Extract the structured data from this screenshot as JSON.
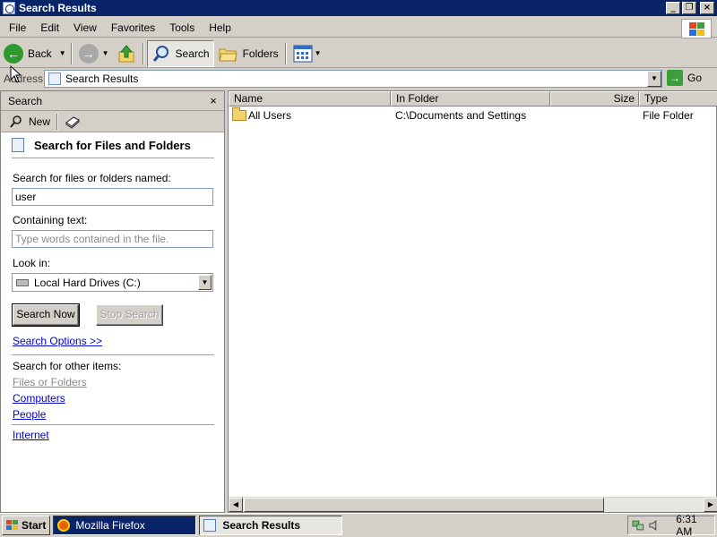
{
  "window": {
    "title": "Search Results",
    "controls": {
      "minimize": "_",
      "maximize": "❐",
      "close": "×"
    }
  },
  "menubar": [
    "File",
    "Edit",
    "View",
    "Favorites",
    "Tools",
    "Help"
  ],
  "toolbar": {
    "back_label": "Back",
    "search_label": "Search",
    "folders_label": "Folders"
  },
  "address": {
    "label": "Address",
    "value": "Search Results",
    "go_label": "Go"
  },
  "search_pane": {
    "header": "Search",
    "close_glyph": "×",
    "new_label": "New",
    "heading": "Search for Files and Folders",
    "named_label": "Search for files or folders named:",
    "named_value": "user",
    "containing_label": "Containing text:",
    "containing_placeholder": "Type words contained in the file.",
    "lookin_label": "Look in:",
    "lookin_value": "Local Hard Drives (C:)",
    "search_now": "Search Now",
    "stop_search": "Stop Search",
    "search_options": "Search Options >>",
    "other_items_label": "Search for other items:",
    "other_items": [
      "Files or Folders",
      "Computers",
      "People"
    ],
    "internet": "Internet"
  },
  "results": {
    "columns": [
      "Name",
      "In Folder",
      "Size",
      "Type"
    ],
    "rows": [
      {
        "name": "All Users",
        "in_folder": "C:\\Documents and Settings",
        "size": "",
        "type": "File Folder"
      }
    ]
  },
  "taskbar": {
    "start_label": "Start",
    "tasks": [
      "Mozilla Firefox",
      "Search Results"
    ],
    "clock": "6:31 AM"
  },
  "colors": {
    "titlebar": "#0a246a",
    "face": "#d4d0c8",
    "link": "#0000cc"
  }
}
